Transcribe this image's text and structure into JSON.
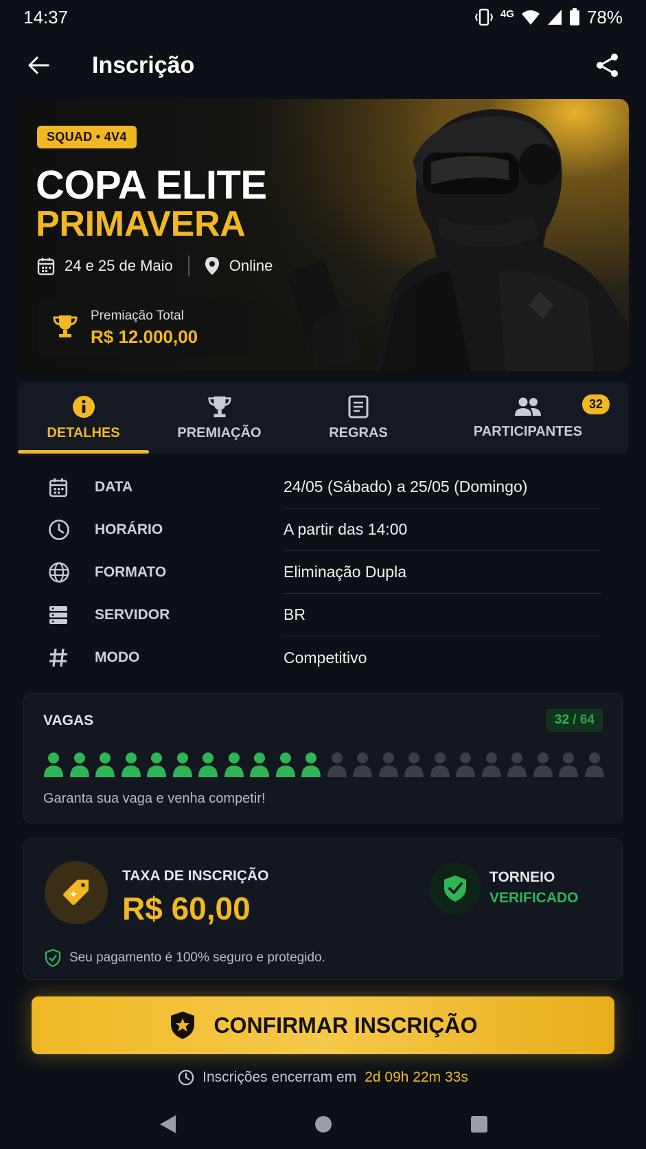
{
  "status_bar": {
    "time": "14:37",
    "network": "4G",
    "battery": "78%"
  },
  "header": {
    "title": "Inscrição"
  },
  "banner": {
    "tag": "SQUAD • 4V4",
    "title_line1": "COPA ELITE",
    "title_line2": "PRIMAVERA",
    "date": "24 e 25 de Maio",
    "location": "Online",
    "prize_label": "Premiação Total",
    "prize_value": "R$ 12.000,00"
  },
  "tabs": [
    {
      "label": "DETALHES",
      "icon": "info-icon",
      "active": true
    },
    {
      "label": "PREMIAÇÃO",
      "icon": "trophy-icon",
      "active": false
    },
    {
      "label": "REGRAS",
      "icon": "document-icon",
      "active": false
    },
    {
      "label": "PARTICIPANTES",
      "icon": "people-icon",
      "active": false,
      "badge": "32"
    }
  ],
  "details": [
    {
      "icon": "calendar-icon",
      "label": "DATA",
      "value": "24/05 (Sábado) a 25/05 (Domingo)"
    },
    {
      "icon": "clock-icon",
      "label": "HORÁRIO",
      "value": "A partir das 14:00"
    },
    {
      "icon": "globe-icon",
      "label": "FORMATO",
      "value": "Eliminação Dupla"
    },
    {
      "icon": "server-icon",
      "label": "SERVIDOR",
      "value": "BR"
    },
    {
      "icon": "hash-icon",
      "label": "MODO",
      "value": "Competitivo"
    }
  ],
  "slots": {
    "title": "VAGAS",
    "filled": "32",
    "separator": "/",
    "total": "64",
    "filled_icons": 11,
    "total_icons": 22,
    "caption": "Garanta sua vaga e venha competir!"
  },
  "fee": {
    "label": "TAXA DE INSCRIÇÃO",
    "value": "R$ 60,00",
    "verified_line1": "TORNEIO",
    "verified_line2": "VERIFICADO",
    "secure_text": "Seu pagamento é 100% seguro e protegido."
  },
  "confirm": {
    "label": "CONFIRMAR INSCRIÇÃO"
  },
  "deadline": {
    "prefix": "Inscrições encerram em",
    "time": "2d 09h 22m 33s"
  },
  "colors": {
    "accent": "#f2b823",
    "success": "#2fb556",
    "background": "#0d1117",
    "card": "#121720"
  }
}
